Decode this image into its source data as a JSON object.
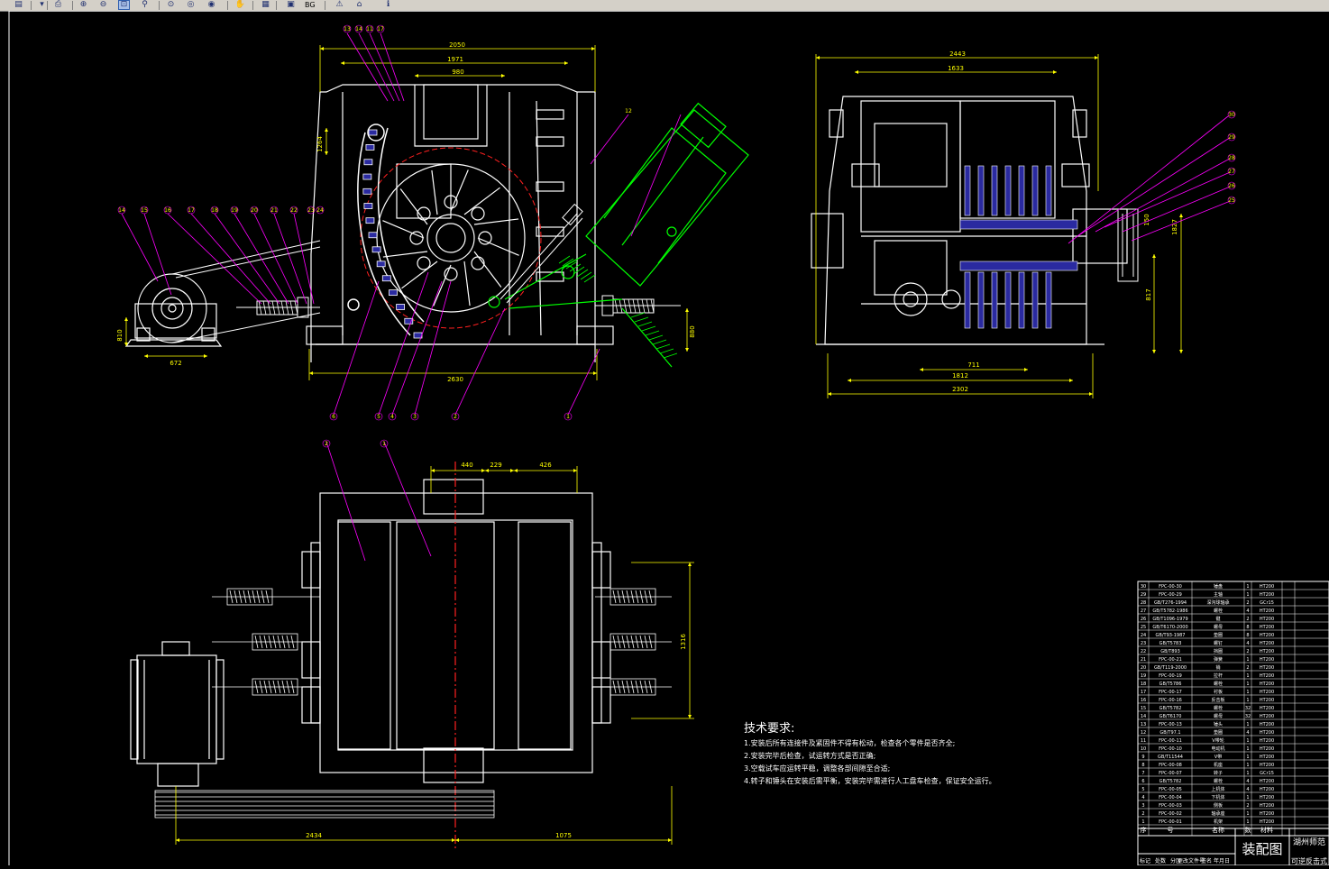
{
  "toolbar": {
    "bg_label": "BG",
    "buttons": [
      {
        "name": "properties-icon",
        "glyph": "▤",
        "active": false
      },
      {
        "name": "dropdown-arrow-icon",
        "glyph": "▾",
        "active": false
      },
      {
        "name": "print-icon",
        "glyph": "⎙",
        "active": false
      },
      {
        "name": "zoom-in-icon",
        "glyph": "⊕",
        "active": false
      },
      {
        "name": "zoom-out-icon",
        "glyph": "⊖",
        "active": false
      },
      {
        "name": "zoom-window-icon",
        "glyph": "⊡",
        "active": true
      },
      {
        "name": "zoom-realtime-icon",
        "glyph": "⚲",
        "active": false
      },
      {
        "name": "zoom-extents-icon",
        "glyph": "⊙",
        "active": false
      },
      {
        "name": "zoom-previous-icon",
        "glyph": "◎",
        "active": false
      },
      {
        "name": "globe-icon",
        "glyph": "◉",
        "active": false
      },
      {
        "name": "pan-icon",
        "glyph": "✋",
        "active": false
      },
      {
        "name": "layer-icon",
        "glyph": "▦",
        "active": false
      },
      {
        "name": "monitor-icon",
        "glyph": "▣",
        "active": false
      },
      {
        "name": "warning-icon",
        "glyph": "⚠",
        "active": false
      },
      {
        "name": "home-icon",
        "glyph": "⌂",
        "active": false
      },
      {
        "name": "info-icon",
        "glyph": "ℹ",
        "active": false
      }
    ]
  },
  "colors": {
    "background": "#000000",
    "white": "#ffffff",
    "yellow": "#ffff00",
    "magenta": "#ff00ff",
    "red": "#ff2020",
    "green": "#00ff00",
    "blue": "#2a2aa0",
    "cyan": "#00ffff"
  },
  "drawing": {
    "front_view": {
      "dims": {
        "overall": "2050",
        "top_width": "1971",
        "inner": "980",
        "bottom": "2630",
        "motor_base": "672",
        "motor_h": "810",
        "right_h": "880",
        "slope": "1264"
      },
      "callouts_top": [
        "13",
        "14",
        "11",
        "17"
      ],
      "callouts_left": [
        "14",
        "15",
        "16",
        "17",
        "18",
        "19",
        "20",
        "21",
        "22",
        "23",
        "24"
      ],
      "callouts_bottom": [
        "6",
        "5",
        "4",
        "3",
        "2",
        "1"
      ],
      "callout_right": "12"
    },
    "side_view": {
      "dims": {
        "top": "2443",
        "inner": "1633",
        "base1": "711",
        "base2": "1812",
        "base3": "2302",
        "height": "1827",
        "right_h": "817",
        "pulley": "150"
      },
      "callouts": [
        "30",
        "29",
        "28",
        "27",
        "26",
        "25"
      ]
    },
    "top_view": {
      "dims": {
        "d1": "440",
        "d2": "229",
        "d3": "426",
        "side": "1316",
        "bottom_left": "2434",
        "bottom_right": "1075"
      },
      "callouts": [
        "2",
        "1"
      ]
    }
  },
  "tech_requirements": {
    "title": "技术要求:",
    "items": [
      "1.安装后所有连接件及紧固件不得有松动，检查各个零件是否齐全;",
      "2.安装完毕后检查，试运转方式是否正确;",
      "3.空载试车应运转平稳，调整各部间隙至合适;",
      "4.转子和锤头在安装后需平衡，安装完毕需进行人工盘车检查，保证安全运行。"
    ]
  },
  "bom": {
    "rows": [
      {
        "no": "30",
        "code": "FPC-00-30",
        "name": "锤盘",
        "qty": "1",
        "mat": "HT200"
      },
      {
        "no": "29",
        "code": "FPC-00-29",
        "name": "主轴",
        "qty": "1",
        "mat": "HT200"
      },
      {
        "no": "28",
        "code": "GB/T276-1994",
        "name": "深沟球轴承",
        "qty": "2",
        "mat": "GCr15"
      },
      {
        "no": "27",
        "code": "GB/T5782-1986",
        "name": "螺栓",
        "qty": "4",
        "mat": "HT200"
      },
      {
        "no": "26",
        "code": "GB/T1096-1979",
        "name": "键",
        "qty": "2",
        "mat": "HT200"
      },
      {
        "no": "25",
        "code": "GB/T6170-2000",
        "name": "螺母",
        "qty": "8",
        "mat": "HT200"
      },
      {
        "no": "24",
        "code": "GB/T93-1987",
        "name": "垫圈",
        "qty": "8",
        "mat": "HT200"
      },
      {
        "no": "23",
        "code": "GB/T5783",
        "name": "螺钉",
        "qty": "4",
        "mat": "HT200"
      },
      {
        "no": "22",
        "code": "GB/T893",
        "name": "挡圈",
        "qty": "2",
        "mat": "HT200"
      },
      {
        "no": "21",
        "code": "FPC-00-21",
        "name": "弹簧",
        "qty": "1",
        "mat": "HT200"
      },
      {
        "no": "20",
        "code": "GB/T119-2000",
        "name": "销",
        "qty": "2",
        "mat": "HT200"
      },
      {
        "no": "19",
        "code": "FPC-00-19",
        "name": "拉杆",
        "qty": "1",
        "mat": "HT200"
      },
      {
        "no": "18",
        "code": "GB/T5786",
        "name": "螺栓",
        "qty": "1",
        "mat": "HT200"
      },
      {
        "no": "17",
        "code": "FPC-00-17",
        "name": "衬板",
        "qty": "1",
        "mat": "HT200"
      },
      {
        "no": "16",
        "code": "FPC-00-16",
        "name": "反击板",
        "qty": "1",
        "mat": "HT200"
      },
      {
        "no": "15",
        "code": "GB/T5782",
        "name": "螺栓",
        "qty": "32",
        "mat": "HT200"
      },
      {
        "no": "14",
        "code": "GB/T6170",
        "name": "螺母",
        "qty": "32",
        "mat": "HT200"
      },
      {
        "no": "13",
        "code": "FPC-00-13",
        "name": "锤头",
        "qty": "1",
        "mat": "HT200"
      },
      {
        "no": "12",
        "code": "GB/T97.1",
        "name": "垫圈",
        "qty": "4",
        "mat": "HT200"
      },
      {
        "no": "11",
        "code": "FPC-00-11",
        "name": "V带轮",
        "qty": "1",
        "mat": "HT200"
      },
      {
        "no": "10",
        "code": "FPC-00-10",
        "name": "电动机",
        "qty": "1",
        "mat": "HT200"
      },
      {
        "no": "9",
        "code": "GB/T11544",
        "name": "V带",
        "qty": "1",
        "mat": "HT200"
      },
      {
        "no": "8",
        "code": "FPC-00-08",
        "name": "机座",
        "qty": "1",
        "mat": "HT200"
      },
      {
        "no": "7",
        "code": "FPC-00-07",
        "name": "转子",
        "qty": "1",
        "mat": "GCr15"
      },
      {
        "no": "6",
        "code": "GB/T5782",
        "name": "螺栓",
        "qty": "4",
        "mat": "HT200"
      },
      {
        "no": "5",
        "code": "FPC-00-05",
        "name": "上机体",
        "qty": "4",
        "mat": "HT200"
      },
      {
        "no": "4",
        "code": "FPC-00-04",
        "name": "下机体",
        "qty": "1",
        "mat": "HT200"
      },
      {
        "no": "3",
        "code": "FPC-00-03",
        "name": "侧板",
        "qty": "2",
        "mat": "HT200"
      },
      {
        "no": "2",
        "code": "FPC-00-02",
        "name": "轴承座",
        "qty": "1",
        "mat": "HT200"
      },
      {
        "no": "1",
        "code": "FPC-00-01",
        "name": "机架",
        "qty": "1",
        "mat": "HT200"
      }
    ],
    "header": {
      "no": "序",
      "code": "号",
      "name": "名称",
      "qty": "数",
      "mat": "材料"
    },
    "title": "装配图",
    "company": "湖州师范",
    "footer": [
      "标记",
      "处数",
      "分区",
      "更改文件号",
      "签名",
      "年月日"
    ],
    "subtitle": "可逆反击式"
  }
}
